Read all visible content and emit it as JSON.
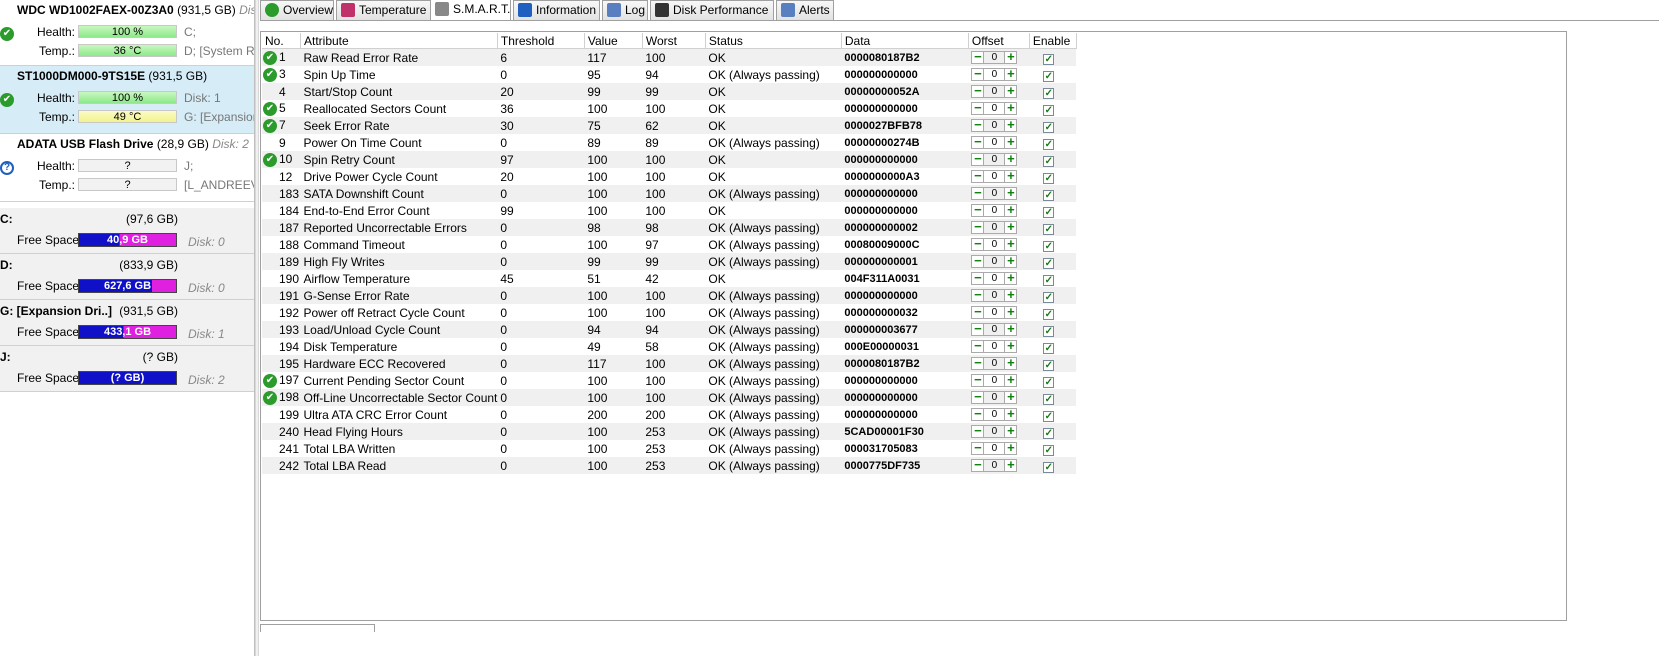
{
  "disks": [
    {
      "name": "WDC WD1002FAEX-00Z3A0",
      "size": "(931,5 GB)",
      "disk": "Disk",
      "health_label": "Health:",
      "health": "100 %",
      "temp_label": "Temp.:",
      "temp": "36 °C",
      "extra1": "C;",
      "extra2": "D;  [System R",
      "status_icon": "ok-icon",
      "temp_color": "green"
    },
    {
      "name": "ST1000DM000-9TS15E",
      "size": "(931,5 GB)",
      "disk": "",
      "health_label": "Health:",
      "health": "100 %",
      "temp_label": "Temp.:",
      "temp": "49 °C",
      "extra1": "Disk: 1",
      "extra2": "G:  [Expansion",
      "status_icon": "ok-icon",
      "temp_color": "yellow"
    },
    {
      "name": "ADATA  USB Flash Drive",
      "size": "(28,9 GB)",
      "disk": "Disk: 2",
      "health_label": "Health:",
      "health": "?",
      "temp_label": "Temp.:",
      "temp": "?",
      "extra1": "J;",
      "extra2": "[L_ANDREEV]",
      "status_icon": "question-icon",
      "temp_color": "grey"
    }
  ],
  "volumes": [
    {
      "name": "C:",
      "size": "(97,6 GB)",
      "free_label": "Free Space",
      "free": "40,9 GB",
      "disk": "Disk: 0",
      "free_fraction": 0.42
    },
    {
      "name": "D:",
      "size": "(833,9 GB)",
      "free_label": "Free Space",
      "free": "627,6 GB",
      "disk": "Disk: 0",
      "free_fraction": 0.75
    },
    {
      "name": "G:  [Expansion Dri..]",
      "size": "(931,5 GB)",
      "free_label": "Free Space",
      "free": "433,1 GB",
      "disk": "Disk: 1",
      "free_fraction": 0.46
    },
    {
      "name": "J:",
      "size": "(? GB)",
      "free_label": "Free Space",
      "free": "(? GB)",
      "disk": "Disk: 2",
      "free_fraction": 0.0
    }
  ],
  "tabs": [
    {
      "label": "Overview",
      "icon": "check-icon"
    },
    {
      "label": "Temperature",
      "icon": "thermometer-icon"
    },
    {
      "label": "S.M.A.R.T.",
      "icon": "wrench-icon",
      "active": true
    },
    {
      "label": "Information",
      "icon": "info-icon"
    },
    {
      "label": "Log",
      "icon": "log-icon"
    },
    {
      "label": "Disk Performance",
      "icon": "gauge-icon"
    },
    {
      "label": "Alerts",
      "icon": "alerts-icon"
    }
  ],
  "columns": [
    "No.",
    "Attribute",
    "Threshold",
    "Value",
    "Worst",
    "Status",
    "Data",
    "Offset",
    "Enable"
  ],
  "rows": [
    {
      "ok": true,
      "no": "1",
      "attr": "Raw Read Error Rate",
      "thr": "6",
      "val": "117",
      "worst": "100",
      "status": "OK",
      "data": "0000080187B2",
      "offset": "0"
    },
    {
      "ok": true,
      "no": "3",
      "attr": "Spin Up Time",
      "thr": "0",
      "val": "95",
      "worst": "94",
      "status": "OK (Always passing)",
      "data": "000000000000",
      "offset": "0"
    },
    {
      "ok": false,
      "no": "4",
      "attr": "Start/Stop Count",
      "thr": "20",
      "val": "99",
      "worst": "99",
      "status": "OK",
      "data": "00000000052A",
      "offset": "0"
    },
    {
      "ok": true,
      "no": "5",
      "attr": "Reallocated Sectors Count",
      "thr": "36",
      "val": "100",
      "worst": "100",
      "status": "OK",
      "data": "000000000000",
      "offset": "0"
    },
    {
      "ok": true,
      "no": "7",
      "attr": "Seek Error Rate",
      "thr": "30",
      "val": "75",
      "worst": "62",
      "status": "OK",
      "data": "0000027BFB78",
      "offset": "0"
    },
    {
      "ok": false,
      "no": "9",
      "attr": "Power On Time Count",
      "thr": "0",
      "val": "89",
      "worst": "89",
      "status": "OK (Always passing)",
      "data": "00000000274B",
      "offset": "0"
    },
    {
      "ok": true,
      "no": "10",
      "attr": "Spin Retry Count",
      "thr": "97",
      "val": "100",
      "worst": "100",
      "status": "OK",
      "data": "000000000000",
      "offset": "0"
    },
    {
      "ok": false,
      "no": "12",
      "attr": "Drive Power Cycle Count",
      "thr": "20",
      "val": "100",
      "worst": "100",
      "status": "OK",
      "data": "0000000000A3",
      "offset": "0"
    },
    {
      "ok": false,
      "no": "183",
      "attr": "SATA Downshift Count",
      "thr": "0",
      "val": "100",
      "worst": "100",
      "status": "OK (Always passing)",
      "data": "000000000000",
      "offset": "0"
    },
    {
      "ok": false,
      "no": "184",
      "attr": "End-to-End Error Count",
      "thr": "99",
      "val": "100",
      "worst": "100",
      "status": "OK",
      "data": "000000000000",
      "offset": "0"
    },
    {
      "ok": false,
      "no": "187",
      "attr": "Reported Uncorrectable Errors",
      "thr": "0",
      "val": "98",
      "worst": "98",
      "status": "OK (Always passing)",
      "data": "000000000002",
      "offset": "0"
    },
    {
      "ok": false,
      "no": "188",
      "attr": "Command Timeout",
      "thr": "0",
      "val": "100",
      "worst": "97",
      "status": "OK (Always passing)",
      "data": "00080009000C",
      "offset": "0"
    },
    {
      "ok": false,
      "no": "189",
      "attr": "High Fly Writes",
      "thr": "0",
      "val": "99",
      "worst": "99",
      "status": "OK (Always passing)",
      "data": "000000000001",
      "offset": "0"
    },
    {
      "ok": false,
      "no": "190",
      "attr": "Airflow Temperature",
      "thr": "45",
      "val": "51",
      "worst": "42",
      "status": "OK",
      "data": "004F311A0031",
      "offset": "0"
    },
    {
      "ok": false,
      "no": "191",
      "attr": "G-Sense Error Rate",
      "thr": "0",
      "val": "100",
      "worst": "100",
      "status": "OK (Always passing)",
      "data": "000000000000",
      "offset": "0"
    },
    {
      "ok": false,
      "no": "192",
      "attr": "Power off Retract Cycle Count",
      "thr": "0",
      "val": "100",
      "worst": "100",
      "status": "OK (Always passing)",
      "data": "000000000032",
      "offset": "0"
    },
    {
      "ok": false,
      "no": "193",
      "attr": "Load/Unload Cycle Count",
      "thr": "0",
      "val": "94",
      "worst": "94",
      "status": "OK (Always passing)",
      "data": "000000003677",
      "offset": "0"
    },
    {
      "ok": false,
      "no": "194",
      "attr": "Disk Temperature",
      "thr": "0",
      "val": "49",
      "worst": "58",
      "status": "OK (Always passing)",
      "data": "000E00000031",
      "offset": "0"
    },
    {
      "ok": false,
      "no": "195",
      "attr": "Hardware ECC Recovered",
      "thr": "0",
      "val": "117",
      "worst": "100",
      "status": "OK (Always passing)",
      "data": "0000080187B2",
      "offset": "0"
    },
    {
      "ok": true,
      "no": "197",
      "attr": "Current Pending Sector Count",
      "thr": "0",
      "val": "100",
      "worst": "100",
      "status": "OK (Always passing)",
      "data": "000000000000",
      "offset": "0"
    },
    {
      "ok": true,
      "no": "198",
      "attr": "Off-Line Uncorrectable Sector Count",
      "thr": "0",
      "val": "100",
      "worst": "100",
      "status": "OK (Always passing)",
      "data": "000000000000",
      "offset": "0"
    },
    {
      "ok": false,
      "no": "199",
      "attr": "Ultra ATA CRC Error Count",
      "thr": "0",
      "val": "200",
      "worst": "200",
      "status": "OK (Always passing)",
      "data": "000000000000",
      "offset": "0"
    },
    {
      "ok": false,
      "no": "240",
      "attr": "Head Flying Hours",
      "thr": "0",
      "val": "100",
      "worst": "253",
      "status": "OK (Always passing)",
      "data": "5CAD00001F30",
      "offset": "0"
    },
    {
      "ok": false,
      "no": "241",
      "attr": "Total LBA Written",
      "thr": "0",
      "val": "100",
      "worst": "253",
      "status": "OK (Always passing)",
      "data": "000031705083",
      "offset": "0"
    },
    {
      "ok": false,
      "no": "242",
      "attr": "Total LBA Read",
      "thr": "0",
      "val": "100",
      "worst": "253",
      "status": "OK (Always passing)",
      "data": "0000775DF735",
      "offset": "0"
    }
  ],
  "colors": {
    "ok_green": "#2b9b2b",
    "free_blue": "#1010c8",
    "free_magenta": "#e020e0",
    "selected_row": "#d6ecf7"
  }
}
